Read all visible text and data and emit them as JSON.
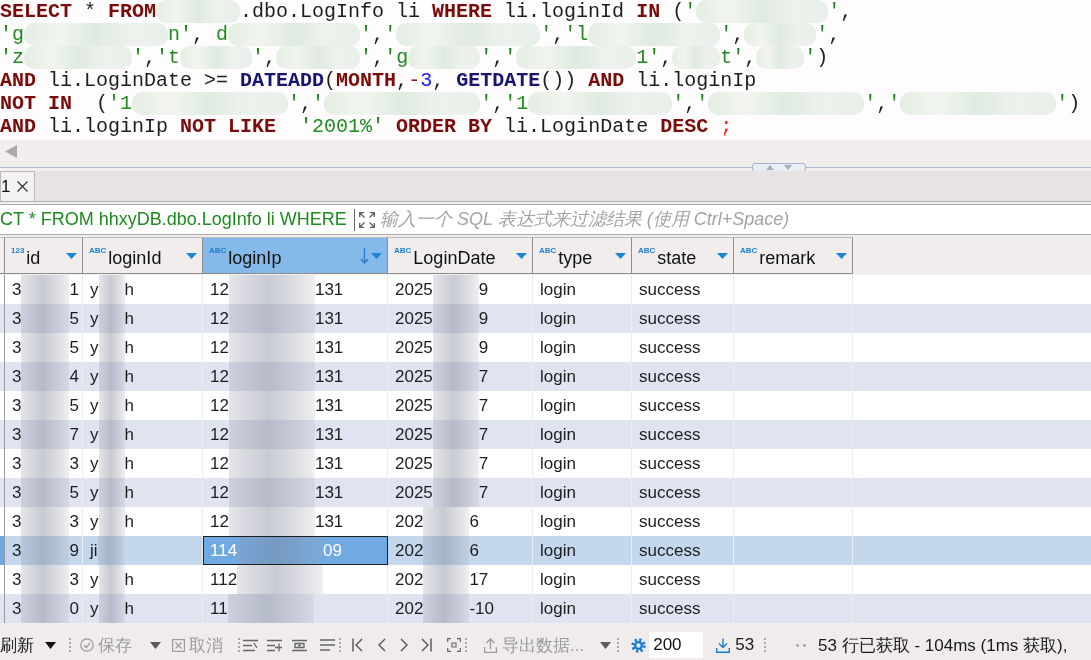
{
  "editor": {
    "lines": [
      [
        {
          "kind": "kw",
          "text": "SELECT"
        },
        {
          "kind": "plain",
          "text": " * "
        },
        {
          "kind": "kw",
          "text": "FROM"
        },
        {
          "kind": "mask"
        },
        {
          "kind": "plain",
          "text": ".dbo.LogInfo li "
        },
        {
          "kind": "kw",
          "text": "WHERE"
        },
        {
          "kind": "plain",
          "text": " li.loginId "
        },
        {
          "kind": "kw",
          "text": "IN"
        },
        {
          "kind": "plain",
          "text": " ("
        },
        {
          "kind": "str",
          "text": "'"
        },
        {
          "kind": "mask"
        },
        {
          "kind": "str",
          "text": "'"
        },
        {
          "kind": "plain",
          "text": ","
        }
      ],
      [
        {
          "kind": "str",
          "text": "'g"
        },
        {
          "kind": "mask"
        },
        {
          "kind": "str",
          "text": "n'"
        },
        {
          "kind": "plain",
          "text": ", "
        },
        {
          "kind": "str",
          "text": "d"
        },
        {
          "kind": "mask"
        },
        {
          "kind": "str",
          "text": "'"
        },
        {
          "kind": "plain",
          "text": ","
        },
        {
          "kind": "str",
          "text": "'"
        },
        {
          "kind": "mask"
        },
        {
          "kind": "str",
          "text": "'"
        },
        {
          "kind": "plain",
          "text": ","
        },
        {
          "kind": "str",
          "text": "'l"
        },
        {
          "kind": "mask"
        },
        {
          "kind": "str",
          "text": "'"
        },
        {
          "kind": "plain",
          "text": ","
        },
        {
          "kind": "mask"
        },
        {
          "kind": "str",
          "text": "'"
        },
        {
          "kind": "plain",
          "text": ","
        }
      ],
      [
        {
          "kind": "str",
          "text": "'z"
        },
        {
          "kind": "mask"
        },
        {
          "kind": "str",
          "text": "'"
        },
        {
          "kind": "plain",
          "text": ","
        },
        {
          "kind": "str",
          "text": "'t"
        },
        {
          "kind": "mask"
        },
        {
          "kind": "str",
          "text": "'"
        },
        {
          "kind": "plain",
          "text": ","
        },
        {
          "kind": "mask"
        },
        {
          "kind": "str",
          "text": "'"
        },
        {
          "kind": "plain",
          "text": ","
        },
        {
          "kind": "str",
          "text": "'g"
        },
        {
          "kind": "mask"
        },
        {
          "kind": "str",
          "text": "'"
        },
        {
          "kind": "plain",
          "text": ","
        },
        {
          "kind": "str",
          "text": "'"
        },
        {
          "kind": "mask"
        },
        {
          "kind": "str",
          "text": "1'"
        },
        {
          "kind": "plain",
          "text": ","
        },
        {
          "kind": "mask"
        },
        {
          "kind": "str",
          "text": "t'"
        },
        {
          "kind": "plain",
          "text": ","
        },
        {
          "kind": "mask"
        },
        {
          "kind": "str",
          "text": "'"
        },
        {
          "kind": "plain",
          "text": ")"
        }
      ],
      [
        {
          "kind": "kw",
          "text": "AND"
        },
        {
          "kind": "plain",
          "text": " li.LoginDate >= "
        },
        {
          "kind": "fn",
          "text": "DATEADD"
        },
        {
          "kind": "plain",
          "text": "("
        },
        {
          "kind": "kw",
          "text": "MONTH"
        },
        {
          "kind": "plain",
          "text": ","
        },
        {
          "kind": "op",
          "text": "-"
        },
        {
          "kind": "num",
          "text": "3"
        },
        {
          "kind": "plain",
          "text": ", "
        },
        {
          "kind": "fn",
          "text": "GETDATE"
        },
        {
          "kind": "plain",
          "text": "()) "
        },
        {
          "kind": "kw",
          "text": "AND"
        },
        {
          "kind": "plain",
          "text": " li.loginIp"
        }
      ],
      [
        {
          "kind": "kw",
          "text": "NOT IN"
        },
        {
          "kind": "plain",
          "text": "  ("
        },
        {
          "kind": "str",
          "text": "'1"
        },
        {
          "kind": "mask"
        },
        {
          "kind": "str",
          "text": "'"
        },
        {
          "kind": "plain",
          "text": ","
        },
        {
          "kind": "str",
          "text": "'"
        },
        {
          "kind": "mask"
        },
        {
          "kind": "str",
          "text": "'"
        },
        {
          "kind": "plain",
          "text": ","
        },
        {
          "kind": "str",
          "text": "'1"
        },
        {
          "kind": "mask"
        },
        {
          "kind": "str",
          "text": "'"
        },
        {
          "kind": "plain",
          "text": ","
        },
        {
          "kind": "str",
          "text": "'"
        },
        {
          "kind": "mask"
        },
        {
          "kind": "str",
          "text": "'"
        },
        {
          "kind": "plain",
          "text": ","
        },
        {
          "kind": "str",
          "text": "'"
        },
        {
          "kind": "mask"
        },
        {
          "kind": "str",
          "text": "'"
        },
        {
          "kind": "plain",
          "text": ")"
        }
      ],
      [
        {
          "kind": "kw",
          "text": "AND"
        },
        {
          "kind": "plain",
          "text": " li.loginIp "
        },
        {
          "kind": "kw",
          "text": "NOT LIKE"
        },
        {
          "kind": "str",
          "text": "  '2001%' "
        },
        {
          "kind": "kw",
          "text": "ORDER BY"
        },
        {
          "kind": "plain",
          "text": " li.LoginDate "
        },
        {
          "kind": "kw",
          "text": "DESC"
        },
        {
          "kind": "end",
          "text": " ;"
        }
      ]
    ]
  },
  "result_tabs": [
    {
      "label": "1",
      "selected": true
    }
  ],
  "filter": {
    "query": "CT * FROM hhxyDB.dbo.LogInfo li WHERE",
    "placeholder": "输入一个 SQL 表达式来过滤结果 (使用 Ctrl+Space)"
  },
  "table": {
    "columns": [
      {
        "label": "id",
        "type_badge": "123",
        "sorted": false,
        "selected": false
      },
      {
        "label": "loginId",
        "type_badge": "ABC",
        "sorted": false,
        "selected": false
      },
      {
        "label": "loginIp",
        "type_badge": "ABC",
        "sorted": true,
        "selected": true
      },
      {
        "label": "LoginDate",
        "type_badge": "ABC",
        "sorted": false,
        "selected": false
      },
      {
        "label": "type",
        "type_badge": "ABC",
        "sorted": false,
        "selected": false
      },
      {
        "label": "state",
        "type_badge": "ABC",
        "sorted": false,
        "selected": false
      },
      {
        "label": "remark",
        "type_badge": "ABC",
        "sorted": false,
        "selected": false
      }
    ],
    "rows": [
      {
        "selected": false,
        "cells": [
          [
            "3",
            "1"
          ],
          [
            "y",
            "h"
          ],
          [
            "12",
            "131"
          ],
          [
            "2025",
            "9"
          ],
          "login",
          "success"
        ]
      },
      {
        "selected": false,
        "cells": [
          [
            "3",
            "5"
          ],
          [
            "y",
            "h"
          ],
          [
            "12",
            "131"
          ],
          [
            "2025",
            "9"
          ],
          "login",
          "success"
        ]
      },
      {
        "selected": false,
        "cells": [
          [
            "3",
            "5"
          ],
          [
            "y",
            "h"
          ],
          [
            "12",
            "131"
          ],
          [
            "2025",
            "9"
          ],
          "login",
          "success"
        ]
      },
      {
        "selected": false,
        "cells": [
          [
            "3",
            "4"
          ],
          [
            "y",
            "h"
          ],
          [
            "12",
            "131"
          ],
          [
            "2025",
            "7"
          ],
          "login",
          "success"
        ]
      },
      {
        "selected": false,
        "cells": [
          [
            "3",
            "5"
          ],
          [
            "y",
            "h"
          ],
          [
            "12",
            "131"
          ],
          [
            "2025",
            "7"
          ],
          "login",
          "success"
        ]
      },
      {
        "selected": false,
        "cells": [
          [
            "3",
            "7"
          ],
          [
            "y",
            "h"
          ],
          [
            "12",
            "131"
          ],
          [
            "2025",
            "7"
          ],
          "login",
          "success"
        ]
      },
      {
        "selected": false,
        "cells": [
          [
            "3",
            "3"
          ],
          [
            "y",
            "h"
          ],
          [
            "12",
            "131"
          ],
          [
            "2025",
            "7"
          ],
          "login",
          "success"
        ]
      },
      {
        "selected": false,
        "cells": [
          [
            "3",
            "5"
          ],
          [
            "y",
            "h"
          ],
          [
            "12",
            "131"
          ],
          [
            "2025",
            "7"
          ],
          "login",
          "success"
        ]
      },
      {
        "selected": false,
        "cells": [
          [
            "3",
            "3"
          ],
          [
            "y",
            "h"
          ],
          [
            "12",
            "131"
          ],
          [
            "202",
            "6"
          ],
          "login",
          "success"
        ]
      },
      {
        "selected": true,
        "cells": [
          [
            "3",
            "9"
          ],
          [
            "ji"
          ],
          [
            "114",
            "09"
          ],
          [
            "202",
            "6"
          ],
          "login",
          "success"
        ]
      },
      {
        "selected": false,
        "cells": [
          [
            "3",
            "3"
          ],
          [
            "y",
            "h"
          ],
          [
            "112"
          ],
          [
            "202",
            "17"
          ],
          "login",
          "success"
        ]
      },
      {
        "selected": false,
        "cells": [
          [
            "3",
            "0"
          ],
          [
            "y",
            "h"
          ],
          [
            "11"
          ],
          [
            "202",
            "-10"
          ],
          "login",
          "success"
        ]
      }
    ]
  },
  "toolbar": {
    "refresh": {
      "label": "刷新",
      "disabled": false
    },
    "save": {
      "label": "保存",
      "disabled": true
    },
    "cancel": {
      "label": "取消",
      "disabled": true
    },
    "export": {
      "label": "导出数据...",
      "disabled": true
    },
    "fetch_size": "200",
    "row_count": "53",
    "status": "53 行已获取 - 104ms (1ms 获取),"
  }
}
